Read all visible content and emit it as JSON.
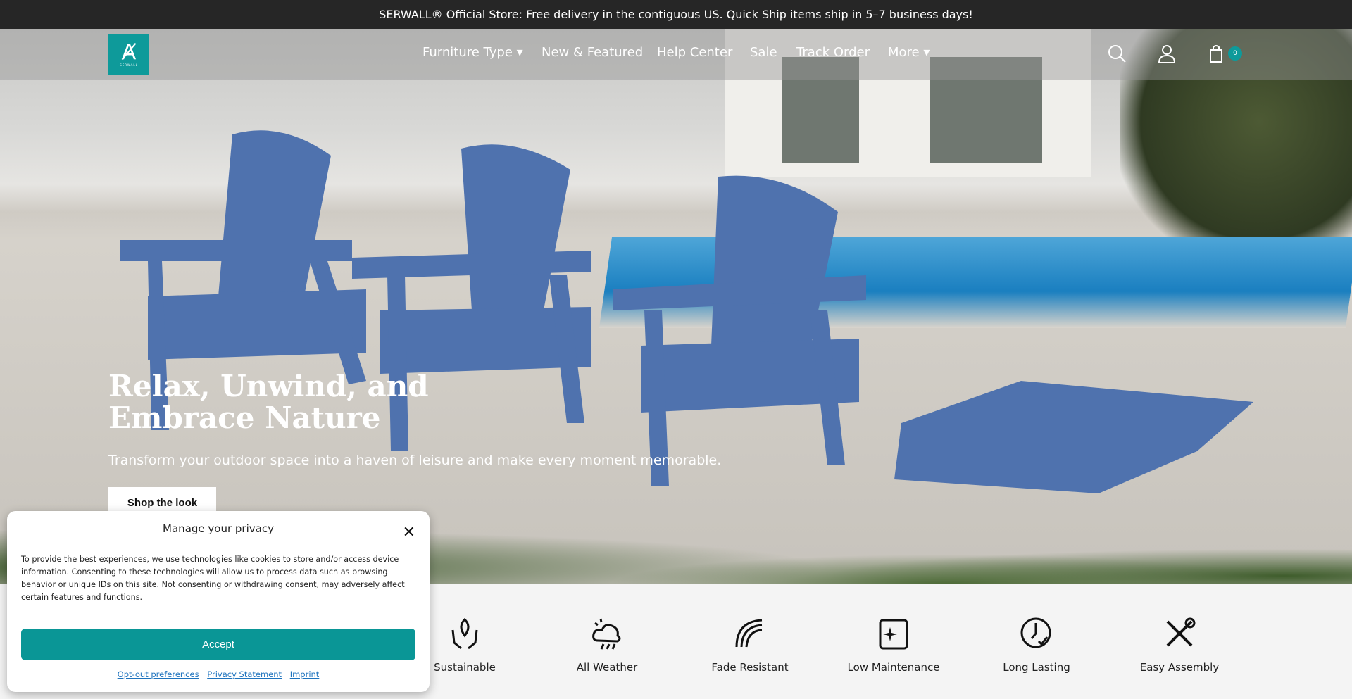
{
  "announcement": "SERWALL® Official Store: Free delivery in the contiguous US. Quick Ship items ship in 5–7 business days!",
  "brand": {
    "logo_text": "SERWALL",
    "accent": "#0e9a9a"
  },
  "nav": {
    "items": [
      {
        "label": "Furniture Type ▾"
      },
      {
        "label": "New & Featured"
      },
      {
        "label": "Help Center"
      },
      {
        "label": "Sale"
      },
      {
        "label": "Track Order"
      },
      {
        "label": "More ▾"
      }
    ],
    "cart_count": "0",
    "icons": [
      "search-icon",
      "user-icon",
      "cart-icon"
    ]
  },
  "hero": {
    "headline": "Relax, Unwind, and Embrace Nature",
    "subtitle": "Transform your outdoor space into a haven of leisure and make every moment memorable.",
    "cta": "Shop the look"
  },
  "features": [
    {
      "label": "Sustainable",
      "icon": "hands-leaf-icon"
    },
    {
      "label": "All Weather",
      "icon": "sun-cloud-rain-icon"
    },
    {
      "label": "Fade Resistant",
      "icon": "rainbow-icon"
    },
    {
      "label": "Low Maintenance",
      "icon": "sparkle-box-icon"
    },
    {
      "label": "Long Lasting",
      "icon": "clock-check-icon"
    },
    {
      "label": "Easy Assembly",
      "icon": "tools-icon"
    }
  ],
  "privacy": {
    "title": "Manage your privacy",
    "body": "To provide the best experiences, we use technologies like cookies to store and/or access device information. Consenting to these technologies will allow us to process data such as browsing behavior or unique IDs on this site. Not consenting or withdrawing consent, may adversely affect certain features and functions.",
    "accept": "Accept",
    "links": [
      "Opt-out preferences",
      "Privacy Statement",
      "Imprint"
    ]
  }
}
